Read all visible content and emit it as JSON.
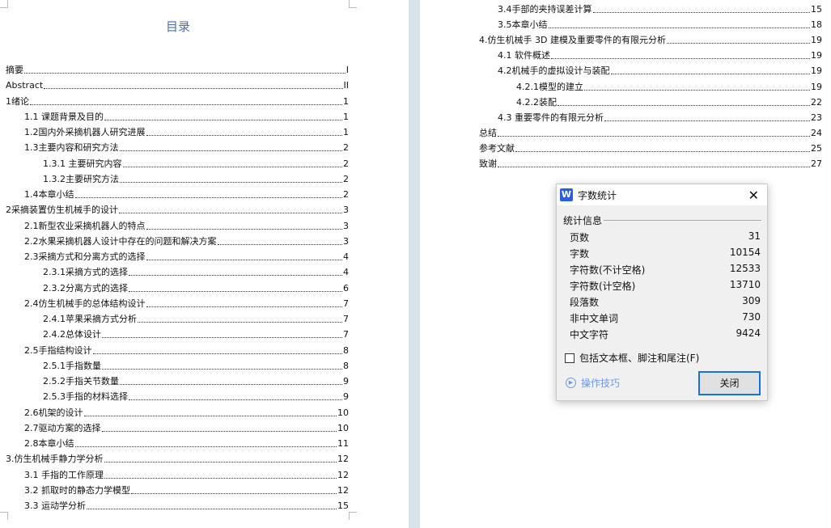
{
  "left_page": {
    "title": "目录",
    "entries": [
      {
        "level": 1,
        "text": "摘要",
        "page": "I"
      },
      {
        "level": 1,
        "text": "Abstract",
        "page": "II"
      },
      {
        "level": 1,
        "text": "1绪论",
        "page": "1"
      },
      {
        "level": 2,
        "text": "1.1 课题背景及目的",
        "page": "1"
      },
      {
        "level": 2,
        "text": "1.2国内外采摘机器人研究进展",
        "page": "1"
      },
      {
        "level": 2,
        "text": "1.3主要内容和研究方法",
        "page": "2"
      },
      {
        "level": 3,
        "text": "1.3.1 主要研究内容",
        "page": "2"
      },
      {
        "level": 3,
        "text": "1.3.2主要研究方法",
        "page": "2"
      },
      {
        "level": 2,
        "text": "1.4本章小结",
        "page": "2"
      },
      {
        "level": 1,
        "text": "2采摘装置仿生机械手的设计",
        "page": "3"
      },
      {
        "level": 2,
        "text": "2.1新型农业采摘机器人的特点",
        "page": "3"
      },
      {
        "level": 2,
        "text": "2.2水果采摘机器人设计中存在的问题和解决方案",
        "page": "3"
      },
      {
        "level": 2,
        "text": "2.3采摘方式和分离方式的选择",
        "page": "4"
      },
      {
        "level": 3,
        "text": "2.3.1采摘方式的选择",
        "page": "4"
      },
      {
        "level": 3,
        "text": "2.3.2分离方式的选择",
        "page": "6"
      },
      {
        "level": 2,
        "text": "2.4仿生机械手的总体结构设计",
        "page": "7"
      },
      {
        "level": 3,
        "text": "2.4.1苹果采摘方式分析",
        "page": "7"
      },
      {
        "level": 3,
        "text": "2.4.2总体设计",
        "page": "7"
      },
      {
        "level": 2,
        "text": "2.5手指结构设计",
        "page": "8"
      },
      {
        "level": 3,
        "text": "2.5.1手指数量",
        "page": "8"
      },
      {
        "level": 3,
        "text": "2.5.2手指关节数量",
        "page": "9"
      },
      {
        "level": 3,
        "text": "2.5.3手指的材料选择",
        "page": "9"
      },
      {
        "level": 2,
        "text": "2.6机架的设计",
        "page": "10"
      },
      {
        "level": 2,
        "text": "2.7驱动方案的选择",
        "page": "10"
      },
      {
        "level": 2,
        "text": "2.8本章小结",
        "page": "11"
      },
      {
        "level": 1,
        "text": "3.仿生机械手静力学分析",
        "page": "12"
      },
      {
        "level": 2,
        "text": "3.1 手指的工作原理",
        "page": "12"
      },
      {
        "level": 2,
        "text": "3.2 抓取时的静态力学模型",
        "page": "12"
      },
      {
        "level": 2,
        "text": "3.3 运动学分析",
        "page": "15"
      }
    ]
  },
  "right_page": {
    "entries": [
      {
        "level": 2,
        "text": "3.4手部的夹持误差计算",
        "page": "15"
      },
      {
        "level": 2,
        "text": "3.5本章小结",
        "page": "18"
      },
      {
        "level": 1,
        "text": "4.仿生机械手 3D 建模及重要零件的有限元分析",
        "page": "19"
      },
      {
        "level": 2,
        "text": "4.1 软件概述",
        "page": "19"
      },
      {
        "level": 2,
        "text": "4.2机械手的虚拟设计与装配",
        "page": "19"
      },
      {
        "level": 3,
        "text": "4.2.1模型的建立",
        "page": "19"
      },
      {
        "level": 3,
        "text": "4.2.2装配",
        "page": "22"
      },
      {
        "level": 2,
        "text": "4.3   重要零件的有限元分析",
        "page": "23"
      },
      {
        "level": 1,
        "text": "总结",
        "page": "24"
      },
      {
        "level": 1,
        "text": "参考文献",
        "page": "25"
      },
      {
        "level": 1,
        "text": "致谢",
        "page": "27"
      }
    ]
  },
  "dialog": {
    "app_icon": "W",
    "title": "字数统计",
    "group_label": "统计信息",
    "stats": [
      {
        "label": "页数",
        "value": "31"
      },
      {
        "label": "字数",
        "value": "10154"
      },
      {
        "label": "字符数(不计空格)",
        "value": "12533"
      },
      {
        "label": "字符数(计空格)",
        "value": "13710"
      },
      {
        "label": "段落数",
        "value": "309"
      },
      {
        "label": "非中文单词",
        "value": "730"
      },
      {
        "label": "中文字符",
        "value": "9424"
      }
    ],
    "checkbox_label": "包括文本框、脚注和尾注(F)",
    "checkbox_checked": false,
    "tips_label": "操作技巧",
    "close_button": "关闭"
  }
}
